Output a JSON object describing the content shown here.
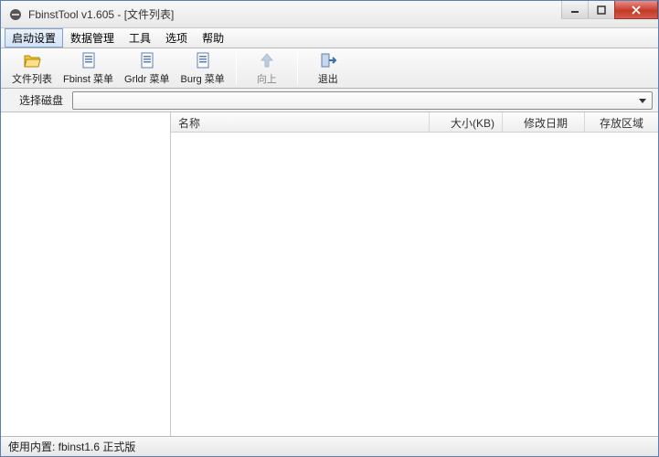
{
  "window": {
    "title": "FbinstTool v1.605 - [文件列表]"
  },
  "menu": {
    "items": [
      "启动设置",
      "数据管理",
      "工具",
      "选项",
      "帮助"
    ],
    "active_index": 0
  },
  "toolbar": {
    "file_list": "文件列表",
    "fbinst_menu": "Fbinst 菜单",
    "grldr_menu": "Grldr 菜单",
    "burg_menu": "Burg 菜单",
    "up": "向上",
    "exit": "退出"
  },
  "disk": {
    "label": "选择磁盘",
    "value": ""
  },
  "columns": {
    "name": "名称",
    "size": "大小(KB)",
    "date": "修改日期",
    "area": "存放区域"
  },
  "rows": [],
  "status": {
    "text": "使用内置: fbinst1.6 正式版"
  }
}
